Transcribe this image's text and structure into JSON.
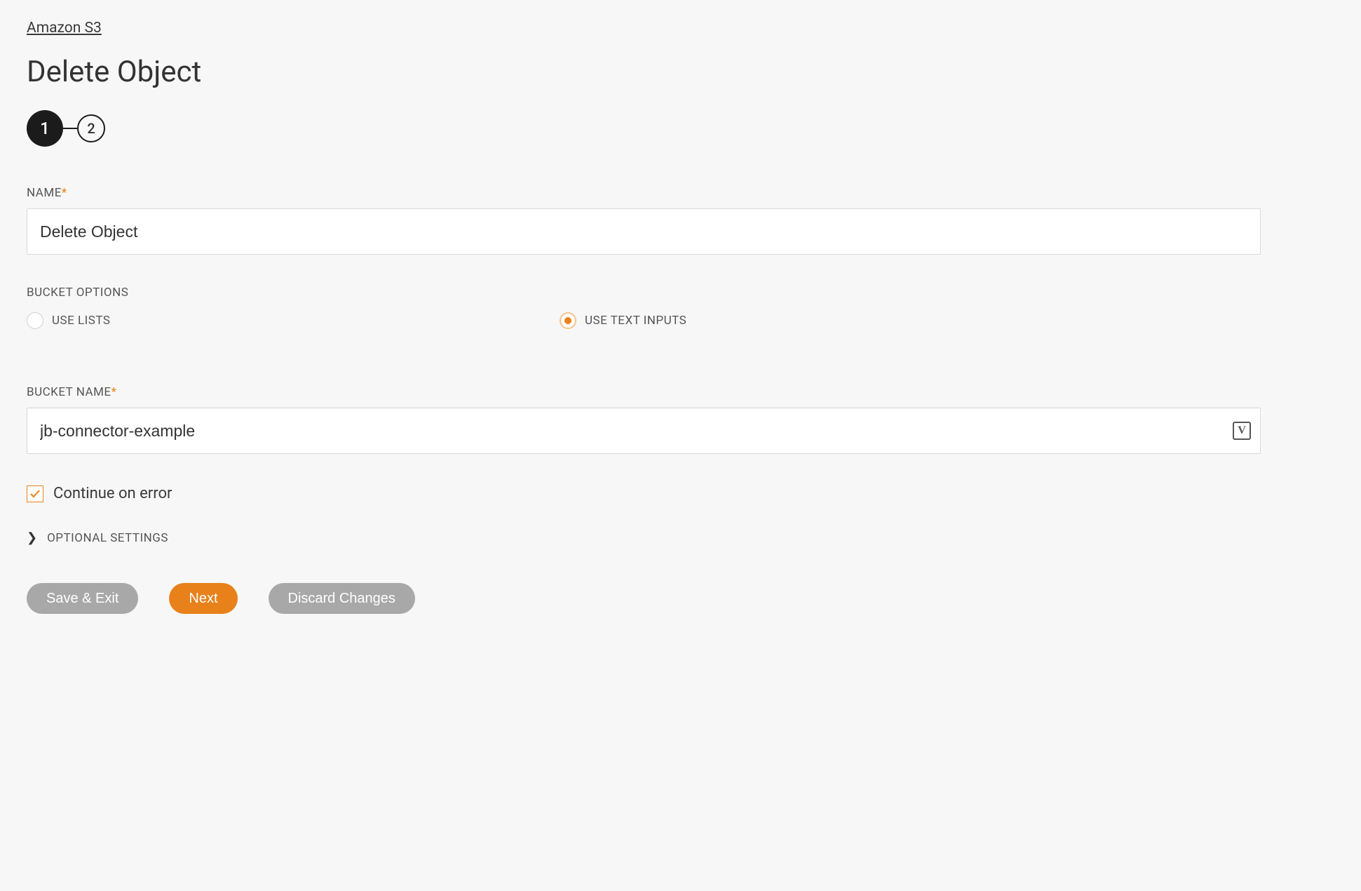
{
  "breadcrumb": {
    "label": "Amazon S3"
  },
  "page": {
    "title": "Delete Object"
  },
  "stepper": {
    "current": "1",
    "next": "2"
  },
  "fields": {
    "name": {
      "label": "NAME",
      "value": "Delete Object",
      "required": true
    },
    "bucket_options": {
      "label": "BUCKET OPTIONS",
      "use_lists": "USE LISTS",
      "use_text_inputs": "USE TEXT INPUTS",
      "selected": "use_text_inputs"
    },
    "bucket_name": {
      "label": "BUCKET NAME",
      "value": "jb-connector-example",
      "required": true
    },
    "continue_on_error": {
      "label": "Continue on error",
      "checked": true
    },
    "optional_settings": {
      "label": "OPTIONAL SETTINGS"
    }
  },
  "buttons": {
    "save_exit": "Save & Exit",
    "next": "Next",
    "discard": "Discard Changes"
  }
}
